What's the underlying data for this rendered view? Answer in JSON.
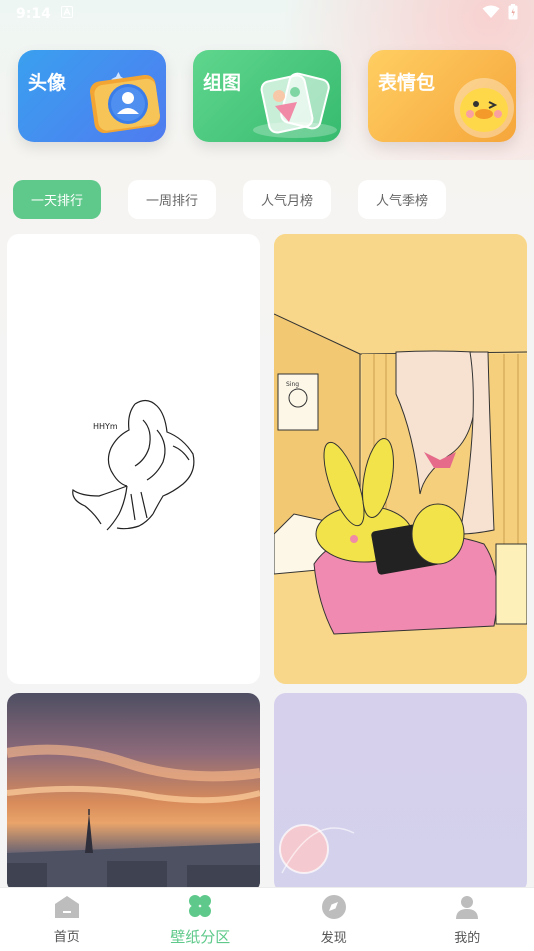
{
  "status_bar": {
    "time": "9:14"
  },
  "categories": [
    {
      "label": "头像",
      "icon": "avatar-card-icon"
    },
    {
      "label": "组图",
      "icon": "photo-stack-icon"
    },
    {
      "label": "表情包",
      "icon": "emoji-duck-icon"
    }
  ],
  "tabs": [
    {
      "label": "一天排行",
      "active": true
    },
    {
      "label": "一周排行",
      "active": false
    },
    {
      "label": "人气月榜",
      "active": false
    },
    {
      "label": "人气季榜",
      "active": false
    }
  ],
  "wallpapers": [
    {
      "name": "line-sketch-hands",
      "text": "HHYm"
    },
    {
      "name": "yellow-bunny-bedroom",
      "text": "Sing"
    },
    {
      "name": "sunset-eiffel-tower"
    },
    {
      "name": "lavender-moon"
    }
  ],
  "nav": [
    {
      "label": "首页",
      "icon": "home-icon"
    },
    {
      "label": "壁纸分区",
      "icon": "clover-icon",
      "active": true
    },
    {
      "label": "发现",
      "icon": "compass-icon"
    },
    {
      "label": "我的",
      "icon": "profile-icon"
    }
  ],
  "colors": {
    "accent": "#5ec98a",
    "blue": "#3f8ff0",
    "green": "#45c57b",
    "orange": "#f7b445"
  }
}
